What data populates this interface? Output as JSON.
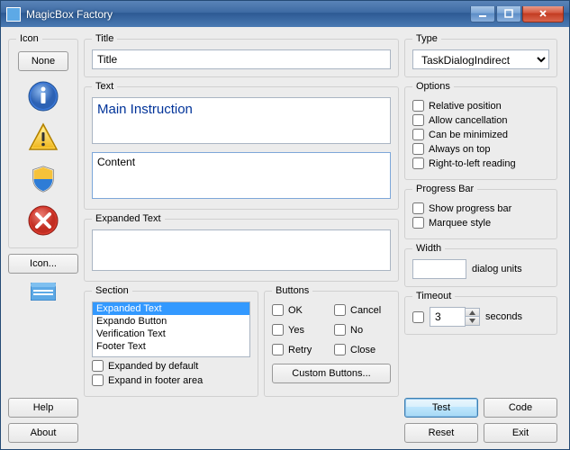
{
  "window": {
    "title": "MagicBox Factory"
  },
  "icon_panel": {
    "legend": "Icon",
    "none_label": "None",
    "icon_button_label": "Icon..."
  },
  "left_buttons": {
    "help": "Help",
    "about": "About"
  },
  "title_panel": {
    "legend": "Title",
    "value": "Title"
  },
  "text_panel": {
    "legend": "Text",
    "main_instruction": "Main Instruction",
    "content": "Content"
  },
  "expanded_panel": {
    "legend": "Expanded Text",
    "value": ""
  },
  "section_panel": {
    "legend": "Section",
    "items": [
      "Expanded Text",
      "Expando Button",
      "Verification Text",
      "Footer Text"
    ],
    "chk_expanded_default": "Expanded by default",
    "chk_expand_footer": "Expand in footer area"
  },
  "buttons_panel": {
    "legend": "Buttons",
    "ok": "OK",
    "cancel": "Cancel",
    "yes": "Yes",
    "no": "No",
    "retry": "Retry",
    "close": "Close",
    "custom": "Custom Buttons..."
  },
  "type_panel": {
    "legend": "Type",
    "selected": "TaskDialogIndirect"
  },
  "options_panel": {
    "legend": "Options",
    "relative": "Relative position",
    "allow_cancel": "Allow cancellation",
    "minimized": "Can be minimized",
    "on_top": "Always on top",
    "rtl": "Right-to-left reading"
  },
  "progress_panel": {
    "legend": "Progress Bar",
    "show": "Show progress bar",
    "marquee": "Marquee style"
  },
  "width_panel": {
    "legend": "Width",
    "value": "",
    "units": "dialog units"
  },
  "timeout_panel": {
    "legend": "Timeout",
    "value": "3",
    "units": "seconds"
  },
  "actions": {
    "test": "Test",
    "code": "Code",
    "reset": "Reset",
    "exit": "Exit"
  }
}
